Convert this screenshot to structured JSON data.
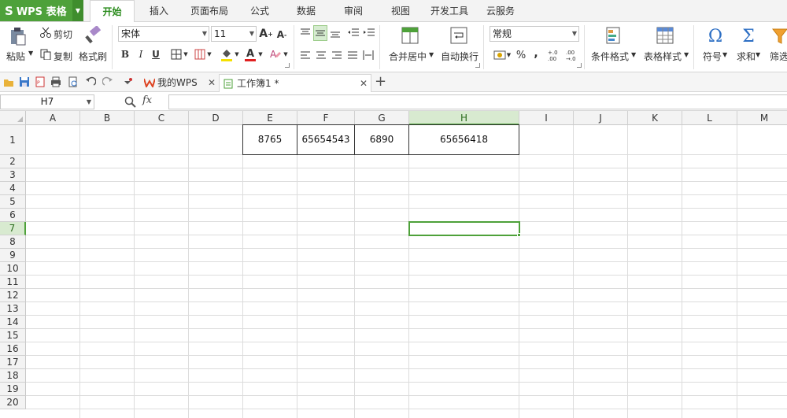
{
  "app": {
    "title": "WPS 表格",
    "logo": "S"
  },
  "menu": {
    "tabs": [
      {
        "label": "开始",
        "active": true
      },
      {
        "label": "插入"
      },
      {
        "label": "页面布局"
      },
      {
        "label": "公式"
      },
      {
        "label": "数据"
      },
      {
        "label": "审阅"
      },
      {
        "label": "视图"
      },
      {
        "label": "开发工具"
      },
      {
        "label": "云服务"
      }
    ]
  },
  "ribbon": {
    "paste": "粘贴",
    "cut": "剪切",
    "copy": "复制",
    "format_painter": "格式刷",
    "font_name": "宋体",
    "font_size": "11",
    "bold": "B",
    "italic": "I",
    "underline": "U",
    "merge_center": "合并居中",
    "wrap_text": "自动换行",
    "number_format": "常规",
    "percent": "%",
    "comma": ",",
    "cond_format": "条件格式",
    "table_style": "表格样式",
    "symbol": "符号",
    "sum": "求和",
    "filter": "筛选"
  },
  "doc_tabs": [
    {
      "label": "我的WPS"
    },
    {
      "label": "工作簿1 *",
      "active": true
    }
  ],
  "formula_bar": {
    "cell_ref": "H7",
    "fx": "fx",
    "content": ""
  },
  "sheet": {
    "columns": [
      "A",
      "B",
      "C",
      "D",
      "E",
      "F",
      "G",
      "H",
      "I",
      "J",
      "K",
      "L",
      "M"
    ],
    "rows": [
      "1",
      "2",
      "3",
      "4",
      "5",
      "6",
      "7",
      "8",
      "9",
      "10",
      "11",
      "12",
      "13",
      "14",
      "15",
      "16",
      "17",
      "18",
      "19",
      "20"
    ],
    "selected_cell": "H7",
    "cells": {
      "E1": "8765",
      "F1": "65654543",
      "G1": "6890",
      "H1": "65656418"
    }
  },
  "colors": {
    "accent": "#4ea13a",
    "app_green": "#4ea13a"
  }
}
